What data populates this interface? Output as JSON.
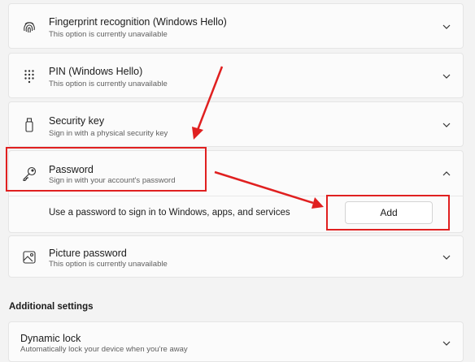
{
  "settings": {
    "fingerprint": {
      "title": "Fingerprint recognition (Windows Hello)",
      "subtitle": "This option is currently unavailable",
      "icon": "fingerprint-icon"
    },
    "pin": {
      "title": "PIN (Windows Hello)",
      "subtitle": "This option is currently unavailable",
      "icon": "keypad-icon"
    },
    "security_key": {
      "title": "Security key",
      "subtitle": "Sign in with a physical security key",
      "icon": "usb-key-icon"
    },
    "password": {
      "title": "Password",
      "subtitle": "Sign in with your account's password",
      "icon": "key-icon",
      "expanded_text": "Use a password to sign in to Windows, apps, and services",
      "add_label": "Add"
    },
    "picture_password": {
      "title": "Picture password",
      "subtitle": "This option is currently unavailable",
      "icon": "picture-icon"
    }
  },
  "additional": {
    "heading": "Additional settings",
    "dynamic_lock": {
      "title": "Dynamic lock",
      "subtitle": "Automatically lock your device when you're away"
    }
  },
  "colors": {
    "annotation_red": "#e02020",
    "card_bg": "#fbfbfb",
    "page_bg": "#f3f3f3"
  }
}
